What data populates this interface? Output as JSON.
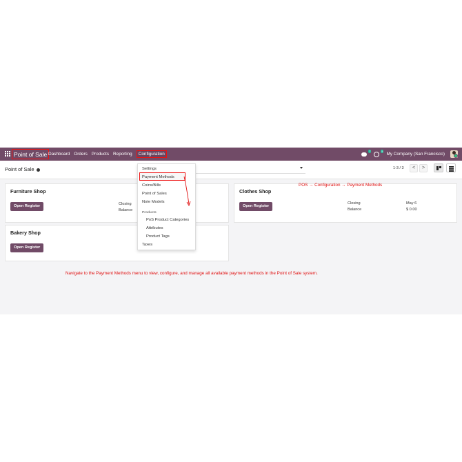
{
  "navbar": {
    "brand": "Point of Sale",
    "menu": [
      "Dashboard",
      "Orders",
      "Products",
      "Reporting",
      "Configuration"
    ],
    "chat_badge": "7",
    "activity_badge": "5",
    "company": "My Company (San Francisco)"
  },
  "control": {
    "title": "Point of Sale",
    "pager": "1-3 / 3",
    "prev": "<",
    "next": ">"
  },
  "dropdown": {
    "items": [
      "Settings",
      "Payment Methods",
      "Coins/Bills",
      "Point of Sales",
      "Note Models"
    ],
    "section": "Products",
    "sub_items": [
      "PoS Product Categories",
      "Attributes",
      "Product Tags"
    ],
    "footer": "Taxes"
  },
  "cards": [
    {
      "name": "Furniture Shop",
      "button": "Open Register",
      "closing_label": "Closing",
      "balance_label": "Balance"
    },
    {
      "name": "Clothes Shop",
      "button": "Open Register",
      "closing_label": "Closing",
      "balance_label": "Balance",
      "closing_value": "May 6",
      "balance_value": "$ 0.00"
    },
    {
      "name": "Bakery Shop",
      "button": "Open Register"
    }
  ],
  "annotations": {
    "path": "POS → Configuration → Payment Methods",
    "note": "Navigate to the Payment Methods menu to view, configure, and manage all available payment methods in the Point of Sale system."
  },
  "colors": {
    "navbar": "#714b67",
    "annotation": "#e01010",
    "button": "#714b67"
  }
}
